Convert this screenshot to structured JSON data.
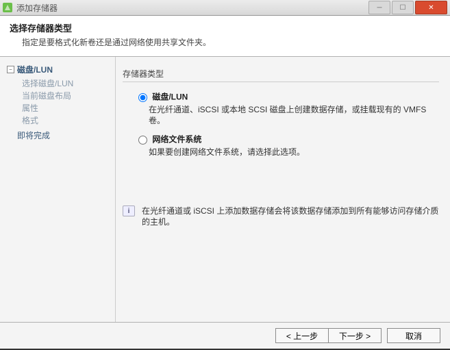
{
  "window": {
    "title": "添加存储器"
  },
  "header": {
    "heading": "选择存储器类型",
    "sub": "指定是要格式化新卷还是通过网络使用共享文件夹。"
  },
  "sidebar": {
    "root": "磁盘/LUN",
    "toggle_glyph": "−",
    "children": [
      "选择磁盘/LUN",
      "当前磁盘布局",
      "属性",
      "格式"
    ],
    "last": "即将完成"
  },
  "content": {
    "group_title": "存储器类型",
    "options": [
      {
        "title": "磁盘/LUN",
        "desc": "在光纤通道、iSCSI 或本地 SCSI 磁盘上创建数据存储，或挂载现有的 VMFS 卷。"
      },
      {
        "title": "网络文件系统",
        "desc": "如果要创建网络文件系统，请选择此选项。"
      }
    ],
    "info": "在光纤通道或 iSCSI 上添加数据存储会将该数据存储添加到所有能够访问存储介质的主机。"
  },
  "footer": {
    "back": "< 上一步",
    "next": "下一步 >",
    "cancel": "取消"
  }
}
